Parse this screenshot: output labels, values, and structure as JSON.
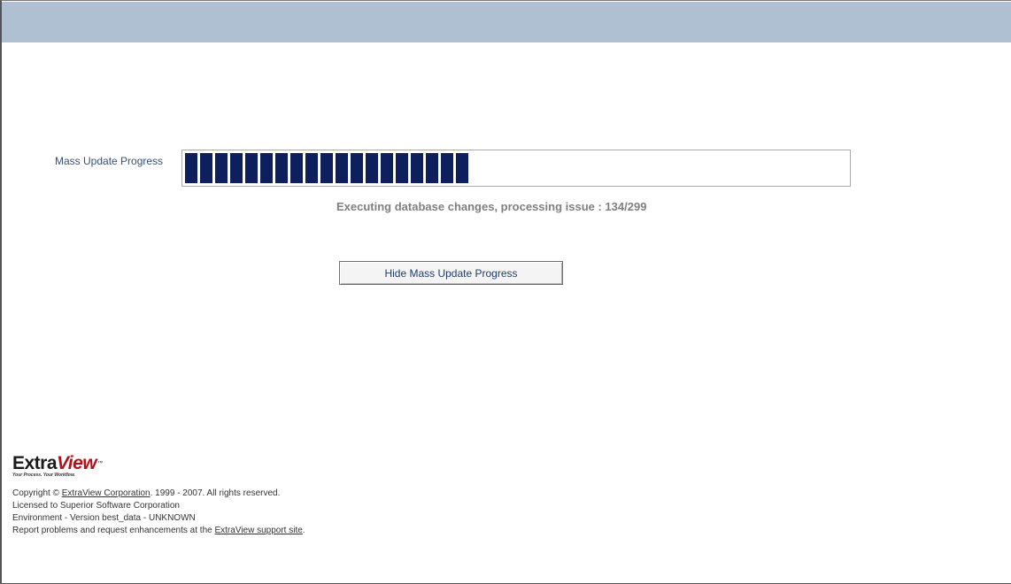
{
  "progress": {
    "label": "Mass Update Progress",
    "completed": 134,
    "total": 299,
    "segments_filled": 19,
    "bar_color": "#0e1f5e",
    "status_text": "Executing database changes, processing issue : 134/299"
  },
  "hide_button": {
    "label": "Hide Mass Update Progress"
  },
  "logo": {
    "text_extra": "Extra",
    "text_view": "View",
    "tm": "™",
    "tagline": "Your Process. Your Workflow.",
    "brand_color": "#b2131a"
  },
  "footer": {
    "copyright_prefix": "Copyright © ",
    "copyright_link": "ExtraView Corporation",
    "copyright_suffix": ". 1999 - 2007.  All rights reserved.",
    "licensed": "Licensed to Superior Software Corporation",
    "environment": "Environment - Version best_data - UNKNOWN",
    "report_prefix": "Report problems and request enhancements at the ",
    "report_link": "ExtraView support site",
    "report_suffix": "."
  },
  "colors": {
    "header_band": "#b0c0d3",
    "label_text": "#34507a",
    "status_text": "#7f7f7f"
  }
}
